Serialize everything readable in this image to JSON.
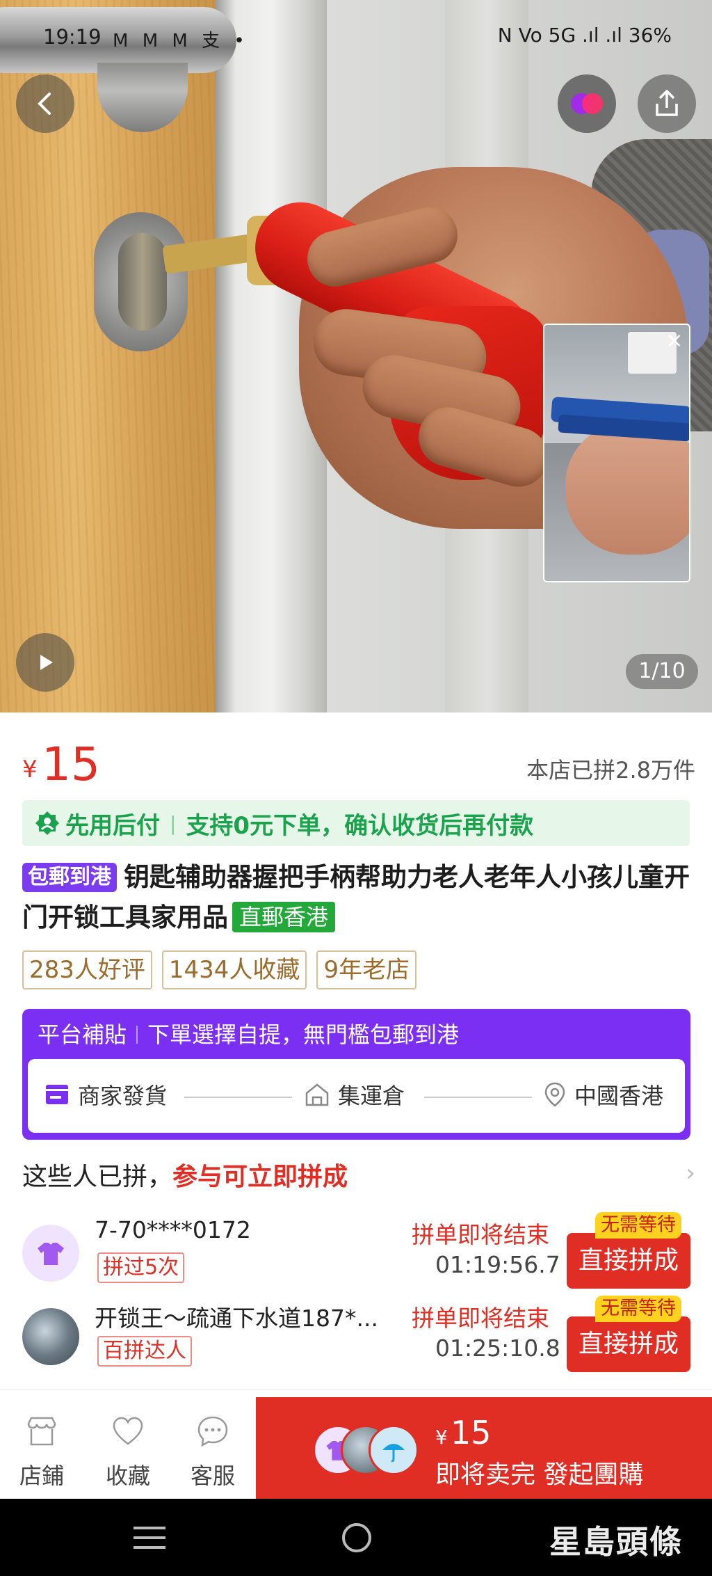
{
  "status_bar": {
    "time": "19:19",
    "left_icons": "M M M 支 •",
    "right_text": "N Vo 5G .ıl .ıl 36%"
  },
  "gallery": {
    "counter": "1/10"
  },
  "price": {
    "symbol": "¥",
    "value": "15",
    "sold": "本店已拼2.8万件"
  },
  "pay_later": {
    "label": "先用后付",
    "desc": "支持0元下单，确认收货后再付款"
  },
  "product": {
    "tag": "包郵到港",
    "title": "钥匙辅助器握把手柄帮助力老人老年人小孩儿童开门开锁工具家用品",
    "badge": "直郵香港"
  },
  "stats": [
    "283人好评",
    "1434人收藏",
    "9年老店"
  ],
  "shipping": {
    "head": "平台補貼",
    "desc": "下單選擇自提，無門檻包郵到港",
    "steps": [
      "商家發貨",
      "集運倉",
      "中國香港"
    ]
  },
  "joined": {
    "prefix": "这些人已拼，",
    "highlight": "参与可立即拼成"
  },
  "groups": [
    {
      "name": "7-70****0172",
      "badge": "拼过5次",
      "status": "拼单即将结束",
      "countdown": "01:19:56.7",
      "button": "直接拼成",
      "pop": "无需等待"
    },
    {
      "name": "开锁王～疏通下水道187*...",
      "badge": "百拼达人",
      "status": "拼单即将结束",
      "countdown": "01:25:10.8",
      "button": "直接拼成",
      "pop": "无需等待"
    }
  ],
  "bottom_nav": {
    "store": "店鋪",
    "favorite": "收藏",
    "service": "客服"
  },
  "cta": {
    "symbol": "¥",
    "price": "15",
    "label": "即将卖完 發起團購"
  },
  "watermark": "星島頭條",
  "colors": {
    "accent_red": "#e02e24",
    "purple": "#7b2ff2",
    "green": "#1aa24d"
  }
}
